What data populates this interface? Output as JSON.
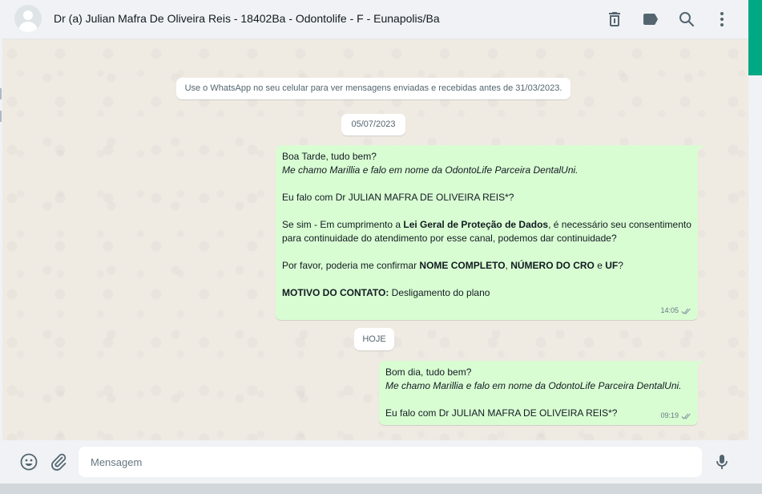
{
  "header": {
    "title": "Dr (a) Julian Mafra De Oliveira Reis - 18402Ba - Odontolife - F - Eunapolis/Ba",
    "icons": [
      "trash-icon",
      "label-icon",
      "search-icon",
      "menu-icon"
    ]
  },
  "chat": {
    "encryption_notice": "Use o WhatsApp no seu celular para ver mensagens enviadas e recebidas antes de 31/03/2023.",
    "date_1": "05/07/2023",
    "message_1": {
      "greeting": "Boa Tarde, tudo bem?",
      "intro": "Me chamo Marillia e falo em nome da OdontoLife Parceira DentalUni.",
      "question": "Eu falo com Dr JULIAN MAFRA DE OLIVEIRA REIS*?",
      "lgpd_prefix": "Se sim - Em cumprimento a ",
      "lgpd_bold": "Lei Geral de Proteção de Dados",
      "lgpd_suffix": ", é necessário seu consentimento para continuidade do atendimento por esse canal, podemos dar continuidade?",
      "confirm_prefix": "Por favor, poderia me confirmar ",
      "confirm_name": "NOME COMPLETO",
      "confirm_sep": ", ",
      "confirm_cro": "NÚMERO DO CRO",
      "confirm_and": " e ",
      "confirm_uf": "UF",
      "confirm_end": "?",
      "motive_label": "MOTIVO DO CONTATO:",
      "motive_value": " Desligamento do plano",
      "time": "14:05"
    },
    "date_2": "HOJE",
    "message_2": {
      "greeting": "Bom dia, tudo bem?",
      "intro": "Me chamo Marillia e falo em nome da OdontoLife Parceira DentalUni.",
      "question": "Eu falo com Dr JULIAN MAFRA DE OLIVEIRA REIS*?",
      "time": "09:19"
    }
  },
  "footer": {
    "placeholder": "Mensagem",
    "icons": [
      "emoji-icon",
      "attach-icon",
      "microphone-icon"
    ]
  },
  "colors": {
    "outgoing_bubble": "#d9fdd3",
    "chat_background": "#efeae2",
    "panel": "#f0f2f5",
    "accent": "#00a884"
  }
}
